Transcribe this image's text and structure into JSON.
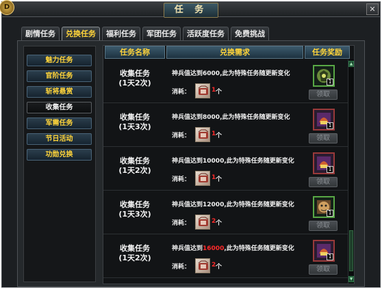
{
  "window": {
    "title": "任 务",
    "emblem": "D",
    "close_icon": "close-icon"
  },
  "tabs": [
    {
      "label": "剧情任务",
      "active": false
    },
    {
      "label": "兑换任务",
      "active": true
    },
    {
      "label": "福利任务",
      "active": false
    },
    {
      "label": "军团任务",
      "active": false
    },
    {
      "label": "活跃度任务",
      "active": false
    },
    {
      "label": "免费挑战",
      "active": false
    }
  ],
  "sidebar": {
    "items": [
      {
        "label": "魅力任务",
        "active": false
      },
      {
        "label": "官阶任务",
        "active": false
      },
      {
        "label": "斩将悬赏",
        "active": false
      },
      {
        "label": "收集任务",
        "active": true
      },
      {
        "label": "军需任务",
        "active": false
      },
      {
        "label": "节日活动",
        "active": false
      },
      {
        "label": "功勋兑换",
        "active": false
      }
    ]
  },
  "table": {
    "headers": {
      "name": "任务名称",
      "requirement": "兑换需求",
      "reward": "任务奖励"
    },
    "consume_label": "消耗：",
    "unit": "个",
    "claim_label": "领取",
    "rows": [
      {
        "name": "收集任务",
        "freq": "(1天2次)",
        "req_prefix": "神兵值达到",
        "req_value": "6000",
        "req_value_highlight": false,
        "req_suffix": ",此为特殊任务随更新变化",
        "qty": "1",
        "reward_count": "1",
        "reward_color": "green",
        "reward_icon": "armor-icon"
      },
      {
        "name": "收集任务",
        "freq": "(1天3次)",
        "req_prefix": "神兵值达到",
        "req_value": "8000",
        "req_value_highlight": false,
        "req_suffix": ",此为特殊任务随更新变化",
        "qty": "1",
        "reward_count": "1",
        "reward_color": "red",
        "reward_icon": "helmet-icon"
      },
      {
        "name": "收集任务",
        "freq": "(1天2次)",
        "req_prefix": "神兵值达到",
        "req_value": "10000",
        "req_value_highlight": false,
        "req_suffix": ",此为特殊任务随更新变化",
        "qty": "1",
        "reward_count": "1",
        "reward_color": "red",
        "reward_icon": "helmet-icon"
      },
      {
        "name": "收集任务",
        "freq": "(1天3次)",
        "req_prefix": "神兵值达到",
        "req_value": "12000",
        "req_value_highlight": false,
        "req_suffix": ",此为特殊任务随更新变化",
        "qty": "2",
        "reward_count": "1",
        "reward_color": "green",
        "reward_icon": "beast-icon"
      },
      {
        "name": "收集任务",
        "freq": "(1天2次)",
        "req_prefix": "神兵值达到",
        "req_value": "16000",
        "req_value_highlight": true,
        "req_suffix": ",此为特殊任务随更新变化",
        "qty": "2",
        "reward_count": "1",
        "reward_color": "red",
        "reward_icon": "helmet-icon"
      }
    ]
  },
  "colors": {
    "accent": "#ffd43a",
    "highlight": "#ff2a2a",
    "panel": "#121416"
  }
}
